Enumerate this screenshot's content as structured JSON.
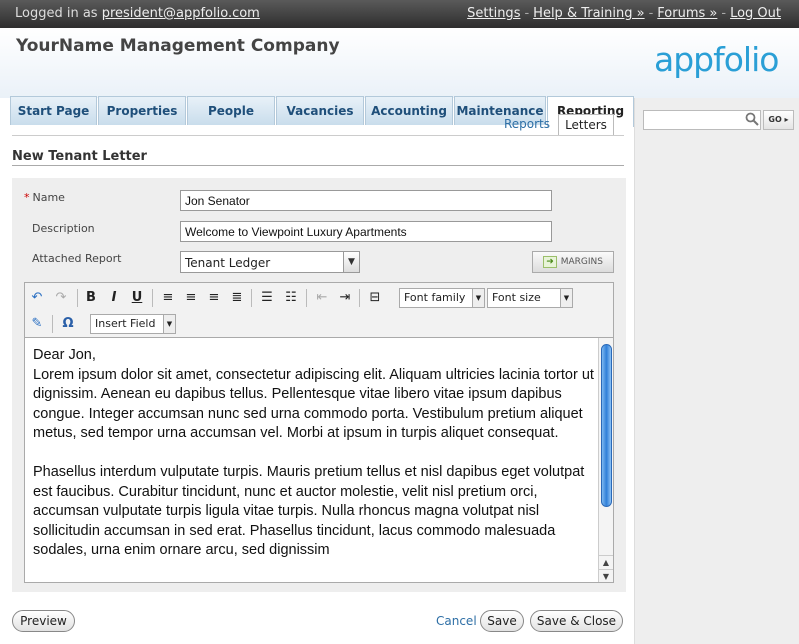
{
  "topbar": {
    "logged_in_prefix": "Logged in as",
    "user_email": "president@appfolio.com",
    "links": [
      "Settings",
      "Help & Training »",
      "Forums »",
      "Log Out"
    ],
    "separator": "-"
  },
  "header": {
    "company": "YourName Management Company",
    "logo": "appfolio"
  },
  "tabs": [
    "Start Page",
    "Properties",
    "People",
    "Vacancies",
    "Accounting",
    "Maintenance",
    "Reporting"
  ],
  "active_tab": "Reporting",
  "subtabs": [
    "Reports",
    "Letters"
  ],
  "active_subtab": "Letters",
  "search": {
    "value": "",
    "go_label": "GO ▸"
  },
  "section_title": "New Tenant Letter",
  "form": {
    "name_label": "Name",
    "name_value": "Jon Senator",
    "description_label": "Description",
    "description_value": "Welcome to Viewpoint Luxury Apartments",
    "attached_report_label": "Attached Report",
    "attached_report_value": "Tenant Ledger",
    "margins_label": "MARGINS"
  },
  "editor": {
    "font_family_label": "Font family",
    "font_size_label": "Font size",
    "insert_field_label": "Insert Field",
    "content": {
      "greeting": "Dear Jon,",
      "paragraph1": "Lorem ipsum dolor sit amet, consectetur adipiscing elit. Aliquam ultricies lacinia tortor ut dignissim. Aenean eu dapibus tellus. Pellentesque vitae libero vitae ipsum dapibus congue. Integer accumsan nunc sed urna commodo porta. Vestibulum pretium aliquet metus, sed tempor urna accumsan vel. Morbi at ipsum in turpis aliquet consequat.",
      "paragraph2": "Phasellus interdum vulputate turpis. Mauris pretium tellus et nisl dapibus eget volutpat est faucibus. Curabitur tincidunt, nunc et auctor molestie, velit nisl pretium orci, accumsan vulputate turpis ligula vitae turpis. Nulla rhoncus magna volutpat nisl sollicitudin accumsan in sed erat. Phasellus tincidunt, lacus commodo malesuada sodales, urna enim ornare arcu, sed dignissim"
    }
  },
  "buttons": {
    "preview": "Preview",
    "cancel": "Cancel",
    "save": "Save",
    "save_close": "Save & Close"
  },
  "colors": {
    "accent": "#2e6fa6",
    "logo": "#2a9fd6",
    "required": "#cc0000"
  }
}
